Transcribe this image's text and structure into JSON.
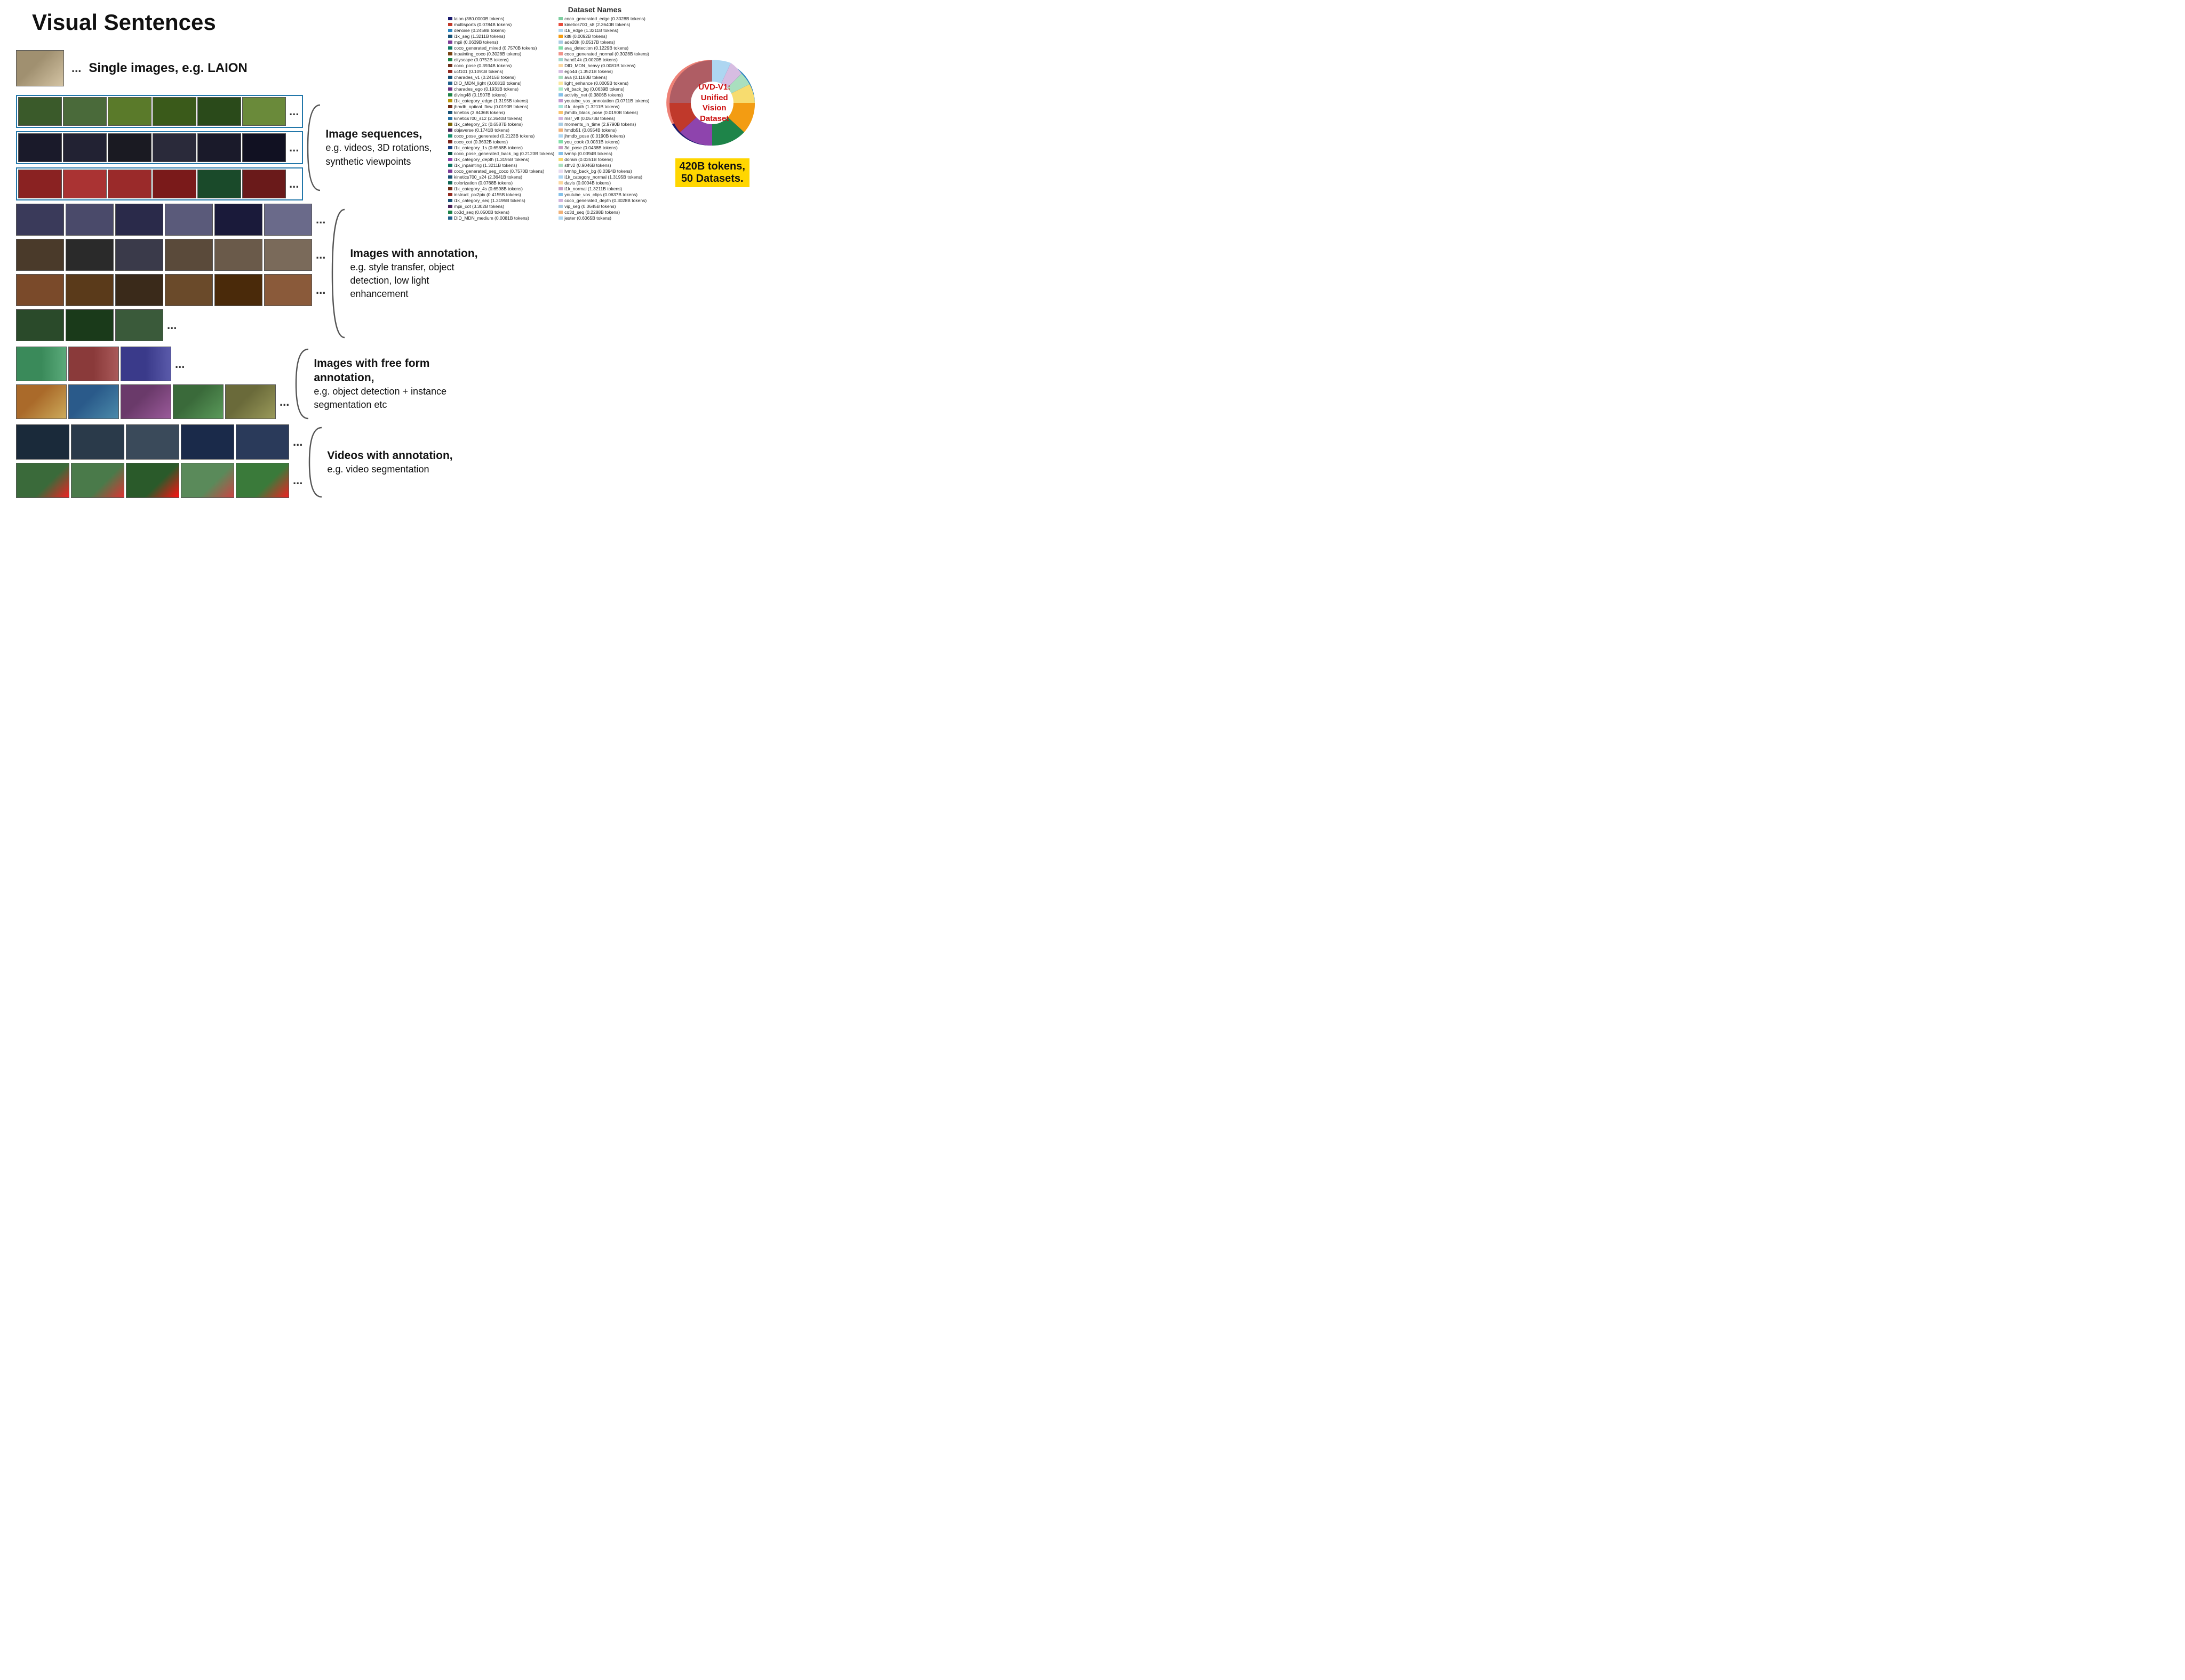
{
  "title": "Visual Sentences",
  "sections": {
    "single_images": {
      "label": "Single images, e.g. LAION",
      "dots": "..."
    },
    "image_sequences": {
      "label": "Image sequences,",
      "sublabel": "e.g. videos, 3D rotations, synthetic viewpoints",
      "dots": "..."
    },
    "images_annotation": {
      "label": "Images with annotation,",
      "sublabel": "e.g. style transfer, object detection, low light enhancement",
      "dots": "..."
    },
    "images_freeform": {
      "label": "Images with free form annotation,",
      "sublabel": "e.g. object detection + instance segmentation etc",
      "dots": "..."
    },
    "videos_annotation": {
      "label": "Videos with annotation,",
      "sublabel": "e.g. video segmentation",
      "dots": "..."
    }
  },
  "chart": {
    "title": "Dataset Names",
    "pie_label": "UVD-V1:\nUnified Vision\nDataset",
    "tokens_label": "420B tokens,\n50 Datasets.",
    "datasets_left": [
      {
        "color": "#1a1a6e",
        "text": "laion (380.0000B tokens)"
      },
      {
        "color": "#c0392b",
        "text": "multisports (0.0784B tokens)"
      },
      {
        "color": "#2e86c1",
        "text": "denoise (0.2458B tokens)"
      },
      {
        "color": "#1a5276",
        "text": "i1k_seg (1.3211B tokens)"
      },
      {
        "color": "#7d3c98",
        "text": "mpii (0.0639B tokens)"
      },
      {
        "color": "#117a65",
        "text": "coco_generated_mixed (0.7570B tokens)"
      },
      {
        "color": "#784212",
        "text": "inpainting_coco (0.3028B tokens)"
      },
      {
        "color": "#1e8449",
        "text": "cityscape (0.0752B tokens)"
      },
      {
        "color": "#6e2f1a",
        "text": "coco_pose (0.3934B tokens)"
      },
      {
        "color": "#922b21",
        "text": "ucf101 (0.1091B tokens)"
      },
      {
        "color": "#1a5276",
        "text": "charades_v1 (0.2415B tokens)"
      },
      {
        "color": "#21618c",
        "text": "DIO_MDN_light (0.0081B tokens)"
      },
      {
        "color": "#6c3483",
        "text": "charades_ego (0.1931B tokens)"
      },
      {
        "color": "#1e8449",
        "text": "diving48 (0.1507B tokens)"
      },
      {
        "color": "#b7950b",
        "text": "i1k_category_edge (1.3195B tokens)"
      },
      {
        "color": "#6e2f1a",
        "text": "jhmdb_optical_flow (0.0190B tokens)"
      },
      {
        "color": "#1a5276",
        "text": "kinetics (3.8436B tokens)"
      },
      {
        "color": "#2874a6",
        "text": "kinetics700_s12 (2.3640B tokens)"
      },
      {
        "color": "#7d6608",
        "text": "i1k_category_2c (0.6587B tokens)"
      },
      {
        "color": "#4a235a",
        "text": "objaverse (0.1741B tokens)"
      },
      {
        "color": "#1a8f6e",
        "text": "coco_pose_generated (0.2123B tokens)"
      },
      {
        "color": "#7b241c",
        "text": "coco_cot (0.3632B tokens)"
      },
      {
        "color": "#1c4587",
        "text": "i1k_category_1s (0.6568B tokens)"
      },
      {
        "color": "#0b5345",
        "text": "coco_pose_generated_back_bg (0.2123B tokens)"
      },
      {
        "color": "#8e44ad",
        "text": "i1k_category_depth (1.3195B tokens)"
      },
      {
        "color": "#117864",
        "text": "i1k_inpainting (1.3211B tokens)"
      },
      {
        "color": "#7d3c98",
        "text": "coco_generated_seg_coco (0.7570B tokens)"
      },
      {
        "color": "#1a5276",
        "text": "kinetics700_s24 (2.3641B tokens)"
      },
      {
        "color": "#0e6655",
        "text": "colorization (0.0768B tokens)"
      },
      {
        "color": "#6e2f1a",
        "text": "i1k_category_4s (0.6598B tokens)"
      },
      {
        "color": "#922b21",
        "text": "instruct_pix2pix (0.4155B tokens)"
      },
      {
        "color": "#1a5276",
        "text": "i1k_category_seq (1.3195B tokens)"
      },
      {
        "color": "#4a235a",
        "text": "mpii_cot (3.302B tokens)"
      },
      {
        "color": "#1e8449",
        "text": "co3d_seq (0.0500B tokens)"
      },
      {
        "color": "#21618c",
        "text": "DID_MDN_medium (0.0081B tokens)"
      }
    ],
    "datasets_right": [
      {
        "color": "#7dcea0",
        "text": "coco_generated_edge (0.3028B tokens)"
      },
      {
        "color": "#e74c3c",
        "text": "kinetics700_s8 (2.3640B tokens)"
      },
      {
        "color": "#aed6f1",
        "text": "i1k_edge (1.3211B tokens)"
      },
      {
        "color": "#f39c12",
        "text": "kitti (0.0092B tokens)"
      },
      {
        "color": "#a9cce3",
        "text": "ade20k (0.0517B tokens)"
      },
      {
        "color": "#82e0aa",
        "text": "ava_detection (0.1229B tokens)"
      },
      {
        "color": "#f1948a",
        "text": "coco_generated_normal (0.3028B tokens)"
      },
      {
        "color": "#a2d9ce",
        "text": "hand14k (0.0020B tokens)"
      },
      {
        "color": "#fad7a0",
        "text": "DID_MDN_heavy (0.0081B tokens)"
      },
      {
        "color": "#d7bde2",
        "text": "ego4d (1.3521B tokens)"
      },
      {
        "color": "#a9dfbf",
        "text": "ava (0.1180B tokens)"
      },
      {
        "color": "#f9e79f",
        "text": "light_enhance (0.0005B tokens)"
      },
      {
        "color": "#abebc6",
        "text": "vit_back_bg (0.0639B tokens)"
      },
      {
        "color": "#85c1e9",
        "text": "activity_net (0.3806B tokens)"
      },
      {
        "color": "#c39bd3",
        "text": "youtube_vos_annotation (0.0711B tokens)"
      },
      {
        "color": "#a3e4d7",
        "text": "i1k_depth (1.3211B tokens)"
      },
      {
        "color": "#f8c471",
        "text": "jhmdb_black_pose (0.0190B tokens)"
      },
      {
        "color": "#d2b4de",
        "text": "msr_vtt (0.0573B tokens)"
      },
      {
        "color": "#a9cce3",
        "text": "moments_in_time (2.9790B tokens)"
      },
      {
        "color": "#f0b27a",
        "text": "hmdb51 (0.0554B tokens)"
      },
      {
        "color": "#aed6f1",
        "text": "jhmdb_pose (0.0190B tokens)"
      },
      {
        "color": "#82e0aa",
        "text": "you_cook (0.0031B tokens)"
      },
      {
        "color": "#c8a2c8",
        "text": "3d_pose (0.0438B tokens)"
      },
      {
        "color": "#85c1e9",
        "text": "lvmhp (0.0394B tokens)"
      },
      {
        "color": "#f7dc6f",
        "text": "dorain (0.0351B tokens)"
      },
      {
        "color": "#a9dfbf",
        "text": "sthv2 (0.9046B tokens)"
      },
      {
        "color": "#e8daef",
        "text": "lvmhp_back_bg (0.0394B tokens)"
      },
      {
        "color": "#aed6f1",
        "text": "i1k_category_normal (1.3195B tokens)"
      },
      {
        "color": "#fad7a0",
        "text": "davis (0.0004B tokens)"
      },
      {
        "color": "#c8a2c8",
        "text": "i1k_normal (1.3211B tokens)"
      },
      {
        "color": "#85c1e9",
        "text": "youtube_vos_clips (0.0637B tokens)"
      },
      {
        "color": "#d2b4de",
        "text": "coco_generated_depth (0.3028B tokens)"
      },
      {
        "color": "#a9cce3",
        "text": "vip_seg (0.0645B tokens)"
      },
      {
        "color": "#f0b27a",
        "text": "co3d_seq (0.2288B tokens)"
      },
      {
        "color": "#aed6f1",
        "text": "jester (0.6065B tokens)"
      }
    ]
  }
}
